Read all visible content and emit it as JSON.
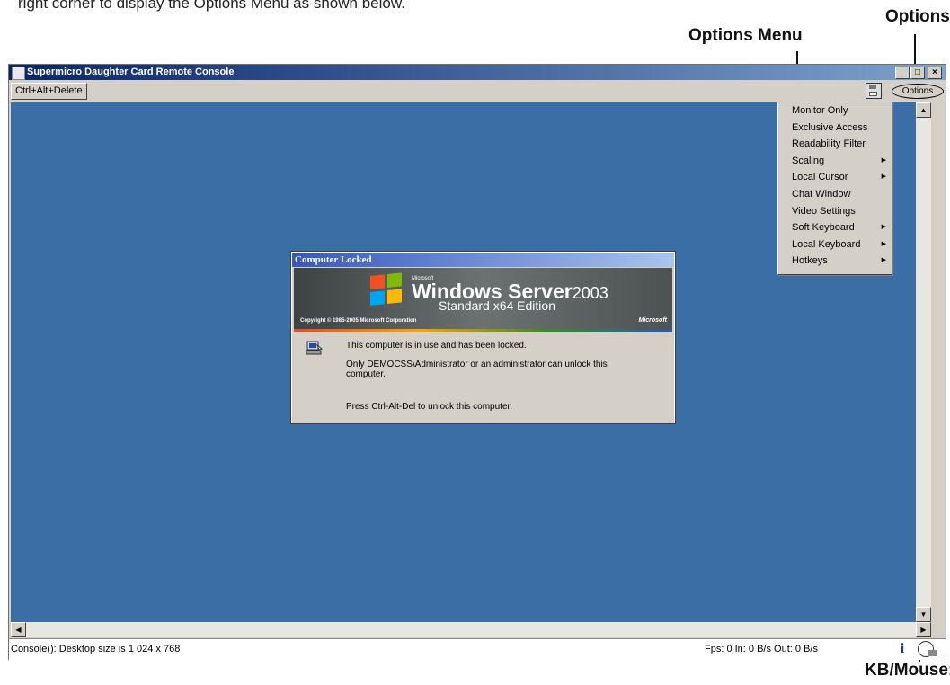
{
  "intro_text": "right corner to display the Options Menu as shown below.",
  "callouts": {
    "options": "Options",
    "options_menu": "Options Menu",
    "kb_mouse": "KB/Mouse:"
  },
  "window": {
    "title": "Supermicro Daughter Card Remote Console",
    "minimize": "_",
    "maximize": "□",
    "close": "×"
  },
  "toolbar": {
    "ctrl_alt_delete": "Ctrl+Alt+Delete",
    "options": "Options"
  },
  "options_menu": {
    "items": [
      {
        "label": "Monitor Only",
        "submenu": false
      },
      {
        "label": "Exclusive Access",
        "submenu": false
      },
      {
        "label": "Readability Filter",
        "submenu": false
      },
      {
        "label": "Scaling",
        "submenu": true
      },
      {
        "label": "Local Cursor",
        "submenu": true
      },
      {
        "label": "Chat Window",
        "submenu": false
      },
      {
        "label": "Video Settings",
        "submenu": false
      },
      {
        "label": "Soft Keyboard",
        "submenu": true
      },
      {
        "label": "Local Keyboard",
        "submenu": true
      },
      {
        "label": "Hotkeys",
        "submenu": true
      }
    ],
    "arrow": "▶"
  },
  "lock_dialog": {
    "title": "Computer Locked",
    "banner_microsoft": "Microsoft",
    "banner_product": "Windows Server",
    "banner_year": "2003",
    "banner_edition": "Standard x64 Edition",
    "copyright": "Copyright © 1985-2005 Microsoft Corporation",
    "logo": "Microsoft",
    "line1": "This computer is in use and has been locked.",
    "line2": "Only DEMOCSS\\Administrator or an administrator can unlock this computer.",
    "line3": "Press Ctrl-Alt-Del to unlock this computer."
  },
  "scrollbars": {
    "up": "▲",
    "down": "▼",
    "left": "◀",
    "right": "▶"
  },
  "status": {
    "left": "Console(): Desktop size is 1 024 x 768",
    "right": "Fps: 0 In: 0 B/s Out: 0 B/s",
    "info_icon": "i"
  },
  "colors": {
    "desktop": "#3a6ea5",
    "titlebar_start": "#0a246a",
    "dialog_title": "#3658bf"
  }
}
